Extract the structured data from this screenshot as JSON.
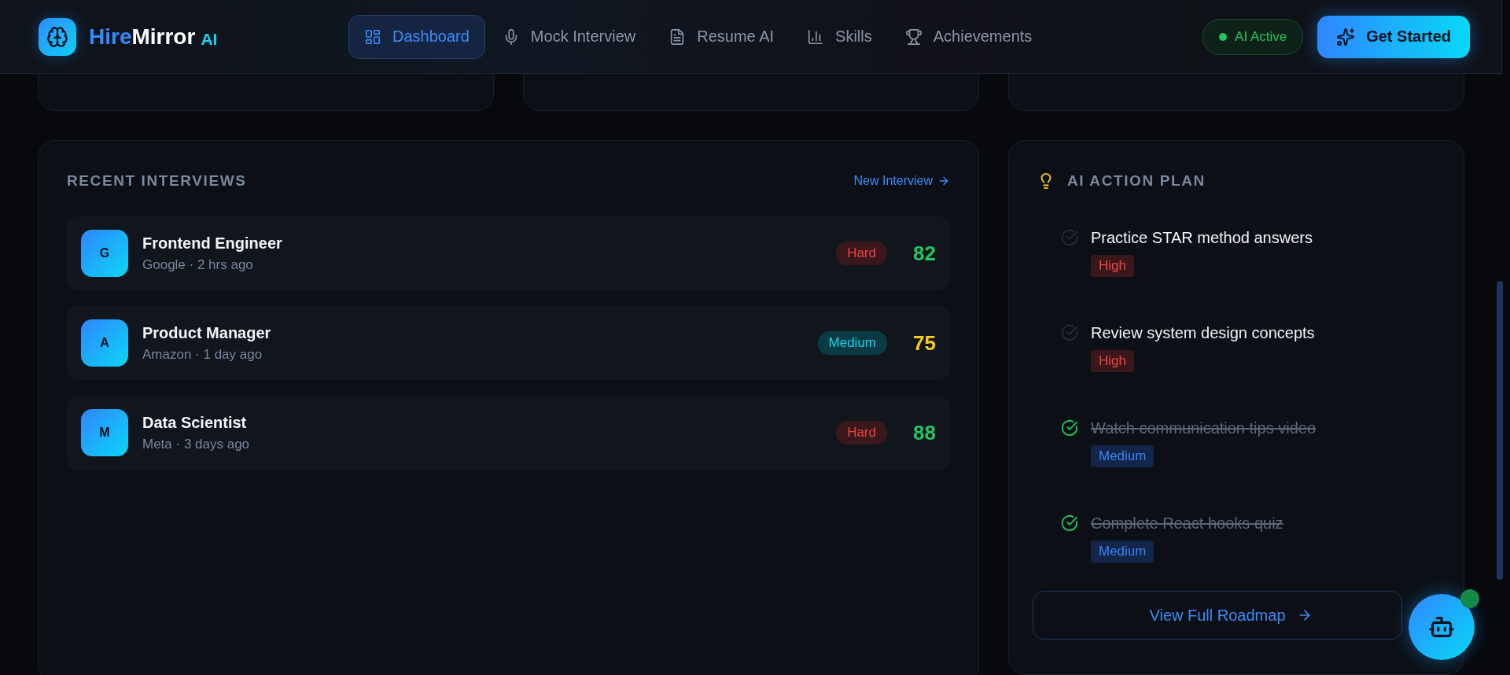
{
  "brand": {
    "name_first": "Hire",
    "name_second": "Mirror",
    "suffix": "AI"
  },
  "nav": [
    {
      "label": "Dashboard",
      "kind": "dashboard",
      "selected": true
    },
    {
      "label": "Mock Interview",
      "kind": "mic",
      "selected": false
    },
    {
      "label": "Resume AI",
      "kind": "document",
      "selected": false
    },
    {
      "label": "Skills",
      "kind": "chart",
      "selected": false
    },
    {
      "label": "Achievements",
      "kind": "trophy",
      "selected": false
    }
  ],
  "status": {
    "label": "AI Active",
    "on": true
  },
  "cta": {
    "label": "Get Started"
  },
  "recent_interviews": {
    "title": "RECENT INTERVIEWS",
    "link": "New Interview",
    "rows": [
      {
        "initial": "G",
        "title": "Frontend Engineer",
        "subtitle": "Google · 2 hrs ago",
        "difficulty": "Hard",
        "kind": "hard",
        "score": "82",
        "color": "#22c55e"
      },
      {
        "initial": "A",
        "title": "Product Manager",
        "subtitle": "Amazon · 1 day ago",
        "difficulty": "Medium",
        "kind": "medium",
        "score": "75",
        "color": "#facc15"
      },
      {
        "initial": "M",
        "title": "Data Scientist",
        "subtitle": "Meta · 3 days ago",
        "difficulty": "Hard",
        "kind": "hard",
        "score": "88",
        "color": "#22c55e"
      }
    ]
  },
  "action_plan": {
    "title": "AI ACTION PLAN",
    "items": [
      {
        "text": "Practice STAR method answers",
        "checked": false,
        "priority": "High",
        "kind": "high"
      },
      {
        "text": "Review system design concepts",
        "checked": false,
        "priority": "High",
        "kind": "high"
      },
      {
        "text": "Watch communication tips video",
        "checked": true,
        "priority": "Medium",
        "kind": "medium"
      },
      {
        "text": "Complete React hooks quiz",
        "checked": true,
        "priority": "Medium",
        "kind": "medium"
      }
    ],
    "button": "View Full Roadmap"
  },
  "assistant": {
    "notification": true
  }
}
